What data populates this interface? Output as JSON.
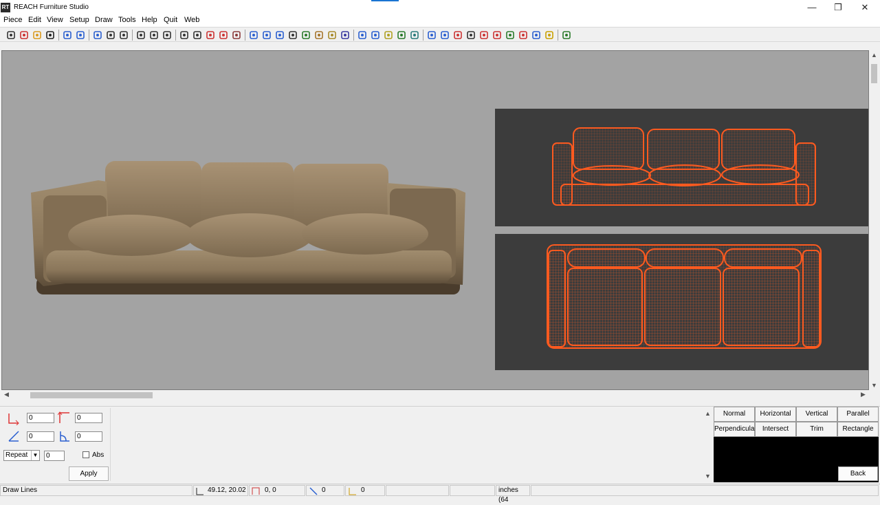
{
  "window": {
    "title": "REACH Furniture Studio",
    "logo_text": "RT",
    "minimize": "—",
    "restore": "❐",
    "close": "✕"
  },
  "menu": [
    {
      "label": "Piece",
      "key": "P"
    },
    {
      "label": "Edit",
      "key": "E"
    },
    {
      "label": "View",
      "key": "V"
    },
    {
      "label": "Setup",
      "key": "S"
    },
    {
      "label": "Draw",
      "key": "D"
    },
    {
      "label": "Tools",
      "key": "T"
    },
    {
      "label": "Help",
      "key": "H"
    },
    {
      "label": "Quit",
      "key": "Q"
    },
    {
      "label": "Web",
      "key": "W"
    }
  ],
  "toolbar_icons": [
    "new-file-icon",
    "add-icon",
    "open-folder-icon",
    "save-icon",
    "undo-icon",
    "redo-icon",
    "select-arrow-icon",
    "cut-icon",
    "move-icon",
    "zoom-in-icon",
    "zoom-out-icon",
    "zoom-fit-icon",
    "line-icon",
    "arc-icon",
    "dimension-vertical-icon",
    "break-icon",
    "circle-point-icon",
    "angle-tool-icon",
    "part-icon",
    "rotate-icon",
    "mirror-icon",
    "assembly-icon",
    "hand-icon",
    "sphere-icon",
    "shade-icon",
    "layout-icon",
    "target-icon",
    "funnel-icon",
    "joints-icon",
    "material-icon",
    "export-icon",
    "open-file-icon",
    "tool-icon",
    "mirror-axis-icon",
    "measure-icon",
    "text-a2-icon",
    "boot-icon",
    "chair-icon",
    "camera-icon",
    "trophy-icon",
    "grid-icon"
  ],
  "coords": {
    "x1": "0",
    "y1": "0",
    "x2": "0",
    "y2": "0",
    "repeat": "Repeat",
    "repeat_count": "0",
    "abs_label": "Abs",
    "apply_label": "Apply"
  },
  "modes": {
    "row1": [
      "Normal",
      "Horizontal",
      "Vertical",
      "Parallel"
    ],
    "row2": [
      "Perpendicular",
      "Intersect",
      "Trim",
      "Rectangle"
    ],
    "back_label": "Back"
  },
  "status": {
    "mode": "Draw Lines",
    "position": "49.12,  20.02",
    "delta": "0,  0",
    "length": "0",
    "angle": "0",
    "units": "inches (64"
  },
  "colors": {
    "viewport_bg": "#a3a3a3",
    "wireframe": "#ff5a1f",
    "wire_panel_bg": "#3c3c3c",
    "sofa_leather": "#8d7a5e"
  }
}
